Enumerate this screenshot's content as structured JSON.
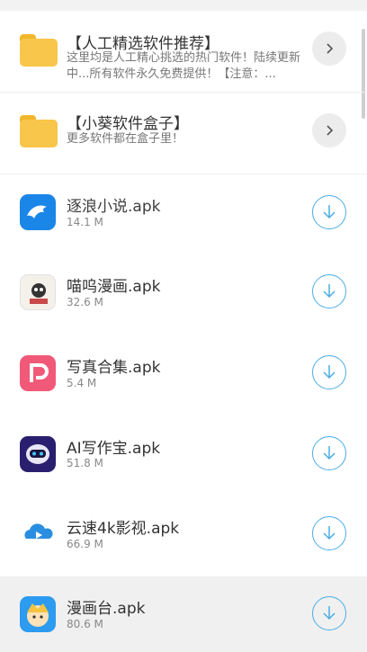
{
  "folders": [
    {
      "title": "【人工精选软件推荐】",
      "desc": "这里均是人工精心挑选的热门软件！陆续更新中...所有软件永久免费提供！【注意：...",
      "icon": "folder-icon",
      "action_icon": "chevron-right-icon"
    },
    {
      "title": "【小葵软件盒子】",
      "desc": "更多软件都在盒子里！",
      "icon": "folder-icon",
      "action_icon": "chevron-right-icon"
    }
  ],
  "files": [
    {
      "name": "逐浪小说.apk",
      "size": "14.1 M",
      "icon": "dolphin-app-icon"
    },
    {
      "name": "喵呜漫画.apk",
      "size": "32.6 M",
      "icon": "cat-comic-app-icon"
    },
    {
      "name": "写真合集.apk",
      "size": "5.4 M",
      "icon": "photo-collection-app-icon"
    },
    {
      "name": "AI写作宝.apk",
      "size": "51.8 M",
      "icon": "robot-app-icon"
    },
    {
      "name": "云速4k影视.apk",
      "size": "66.9 M",
      "icon": "cloud-video-app-icon"
    },
    {
      "name": "漫画台.apk",
      "size": "80.6 M",
      "icon": "cartoon-face-app-icon"
    }
  ],
  "colors": {
    "accent": "#4aaee6",
    "folder": "#f8c64a",
    "highlight_row": "#f0f0f0"
  }
}
